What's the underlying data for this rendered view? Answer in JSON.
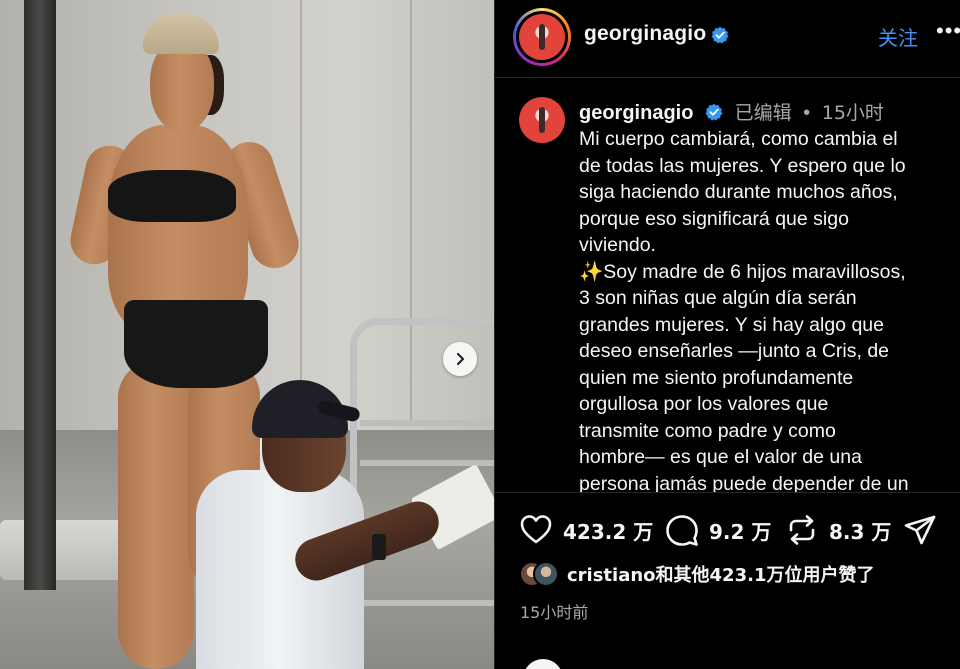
{
  "post": {
    "username": "georginagio",
    "follow_label": "关注",
    "more_label": "•••",
    "caption_username": "georginagio",
    "edited_label": "已编辑",
    "dot": "•",
    "time": "15小时",
    "caption_lines": [
      "Mi cuerpo cambiará, como cambia el",
      "de todas las mujeres. Y espero que lo",
      "siga haciendo durante muchos años,",
      "porque eso significará que sigo",
      "viviendo.",
      "✨Soy madre de 6 hijos maravillosos,",
      "3 son niñas que algún día serán",
      "grandes mujeres. Y si hay algo que",
      "deseo enseñarles —junto a Cris, de",
      "quien me siento profundamente",
      "orgullosa por los valores que",
      "transmite como padre y como",
      "hombre— es que el valor de una",
      "persona jamás puede depender de un"
    ]
  },
  "actions": {
    "likes": "423.2 万",
    "comments": "9.2 万",
    "reposts": "8.3 万"
  },
  "liked_by": "cristiano和其他423.1万位用户赞了",
  "posted_ago": "15小时前",
  "icons": {
    "verified": "verified-badge-icon",
    "like": "heart-icon",
    "comment": "comment-bubble-icon",
    "repost": "repost-arrows-icon",
    "share": "send-plane-icon",
    "next": "chevron-right-icon"
  },
  "colors": {
    "accent": "#4a8ff0",
    "verified": "#3897f0",
    "muted": "#a8a8a8"
  }
}
